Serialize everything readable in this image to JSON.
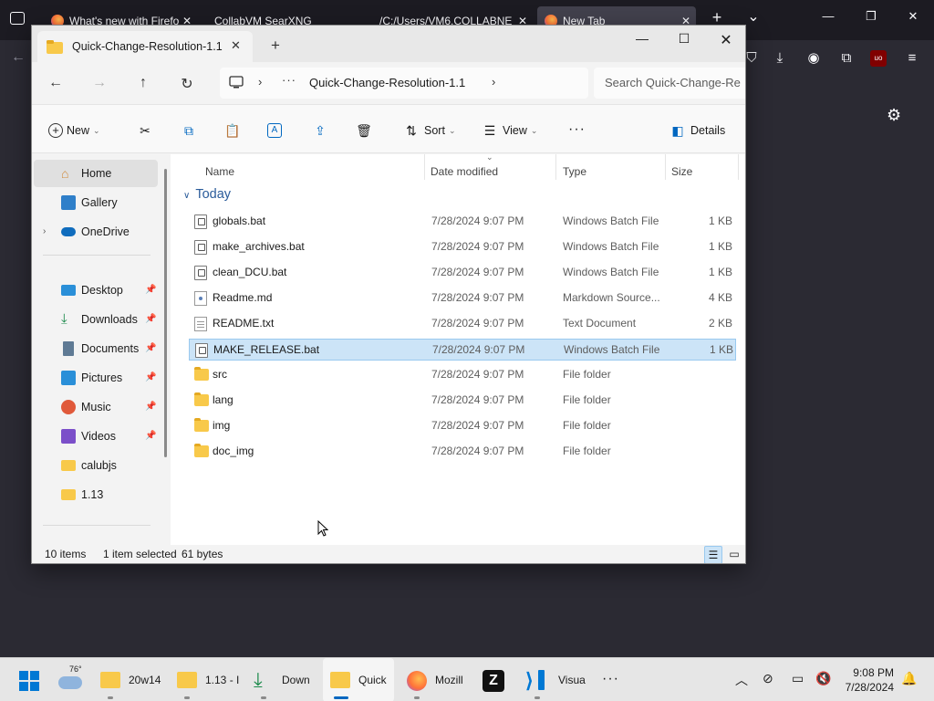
{
  "browser": {
    "tabs": [
      {
        "title": "What's new with Firefo",
        "active": false
      },
      {
        "title": "CollabVM SearXNG",
        "active": false
      },
      {
        "title": "/C:/Users/VM6.COLLABNE",
        "active": false
      },
      {
        "title": "New Tab",
        "active": true
      }
    ],
    "new_tab_symbol": "+",
    "list_tabs_symbol": "⌄"
  },
  "explorer": {
    "tab_title": "Quick-Change-Resolution-1.1",
    "new_tab_symbol": "+",
    "address": {
      "path": "Quick-Change-Resolution-1.1"
    },
    "search_placeholder": "Search Quick-Change-Re",
    "commands": {
      "new": "New",
      "sort": "Sort",
      "view": "View",
      "more": "···",
      "details": "Details"
    },
    "nav": [
      {
        "label": "Home",
        "icon": "home-icon",
        "selected": true
      },
      {
        "label": "Gallery",
        "icon": "gallery-icon"
      },
      {
        "label": "OneDrive",
        "icon": "cloud-icon",
        "expandable": true
      },
      {
        "label": "Desktop",
        "icon": "desktop-icon",
        "pinned": true
      },
      {
        "label": "Downloads",
        "icon": "download-icon",
        "pinned": true
      },
      {
        "label": "Documents",
        "icon": "document-icon",
        "pinned": true
      },
      {
        "label": "Pictures",
        "icon": "picture-icon",
        "pinned": true
      },
      {
        "label": "Music",
        "icon": "music-icon",
        "pinned": true
      },
      {
        "label": "Videos",
        "icon": "video-icon",
        "pinned": true
      },
      {
        "label": "calubjs",
        "icon": "folder-icon"
      },
      {
        "label": "1.13",
        "icon": "folder-icon"
      }
    ],
    "columns": {
      "name": "Name",
      "date": "Date modified",
      "type": "Type",
      "size": "Size"
    },
    "group_label": "Today",
    "files": [
      {
        "name": "globals.bat",
        "date": "7/28/2024 9:07 PM",
        "type": "Windows Batch File",
        "size": "1 KB",
        "kind": "bat"
      },
      {
        "name": "make_archives.bat",
        "date": "7/28/2024 9:07 PM",
        "type": "Windows Batch File",
        "size": "1 KB",
        "kind": "bat"
      },
      {
        "name": "clean_DCU.bat",
        "date": "7/28/2024 9:07 PM",
        "type": "Windows Batch File",
        "size": "1 KB",
        "kind": "bat"
      },
      {
        "name": "Readme.md",
        "date": "7/28/2024 9:07 PM",
        "type": "Markdown Source...",
        "size": "4 KB",
        "kind": "md"
      },
      {
        "name": "README.txt",
        "date": "7/28/2024 9:07 PM",
        "type": "Text Document",
        "size": "2 KB",
        "kind": "txt"
      },
      {
        "name": "MAKE_RELEASE.bat",
        "date": "7/28/2024 9:07 PM",
        "type": "Windows Batch File",
        "size": "1 KB",
        "kind": "bat",
        "selected": true
      },
      {
        "name": "src",
        "date": "7/28/2024 9:07 PM",
        "type": "File folder",
        "size": "",
        "kind": "folder"
      },
      {
        "name": "lang",
        "date": "7/28/2024 9:07 PM",
        "type": "File folder",
        "size": "",
        "kind": "folder"
      },
      {
        "name": "img",
        "date": "7/28/2024 9:07 PM",
        "type": "File folder",
        "size": "",
        "kind": "folder"
      },
      {
        "name": "doc_img",
        "date": "7/28/2024 9:07 PM",
        "type": "File folder",
        "size": "",
        "kind": "folder"
      }
    ],
    "status": {
      "count": "10 items",
      "selection": "1 item selected",
      "size": "61 bytes"
    }
  },
  "taskbar": {
    "weather_temp": "76°",
    "items": [
      {
        "label": "20w14",
        "icon": "folder-icon"
      },
      {
        "label": "1.13 - I",
        "icon": "folder-icon"
      },
      {
        "label": "Down",
        "icon": "download-icon"
      },
      {
        "label": "Quick",
        "icon": "folder-icon",
        "active": true
      },
      {
        "label": "Mozill",
        "icon": "firefox-icon"
      },
      {
        "label": "",
        "icon": "zed-icon"
      },
      {
        "label": "Visua",
        "icon": "vscode-icon"
      }
    ],
    "more": "···",
    "time": "9:08 PM",
    "date": "7/28/2024"
  },
  "colors": {
    "accent": "#0067c0",
    "selection": "#cce4f7",
    "folder": "#f8c94a",
    "firefox_bg": "#2b2a33"
  }
}
